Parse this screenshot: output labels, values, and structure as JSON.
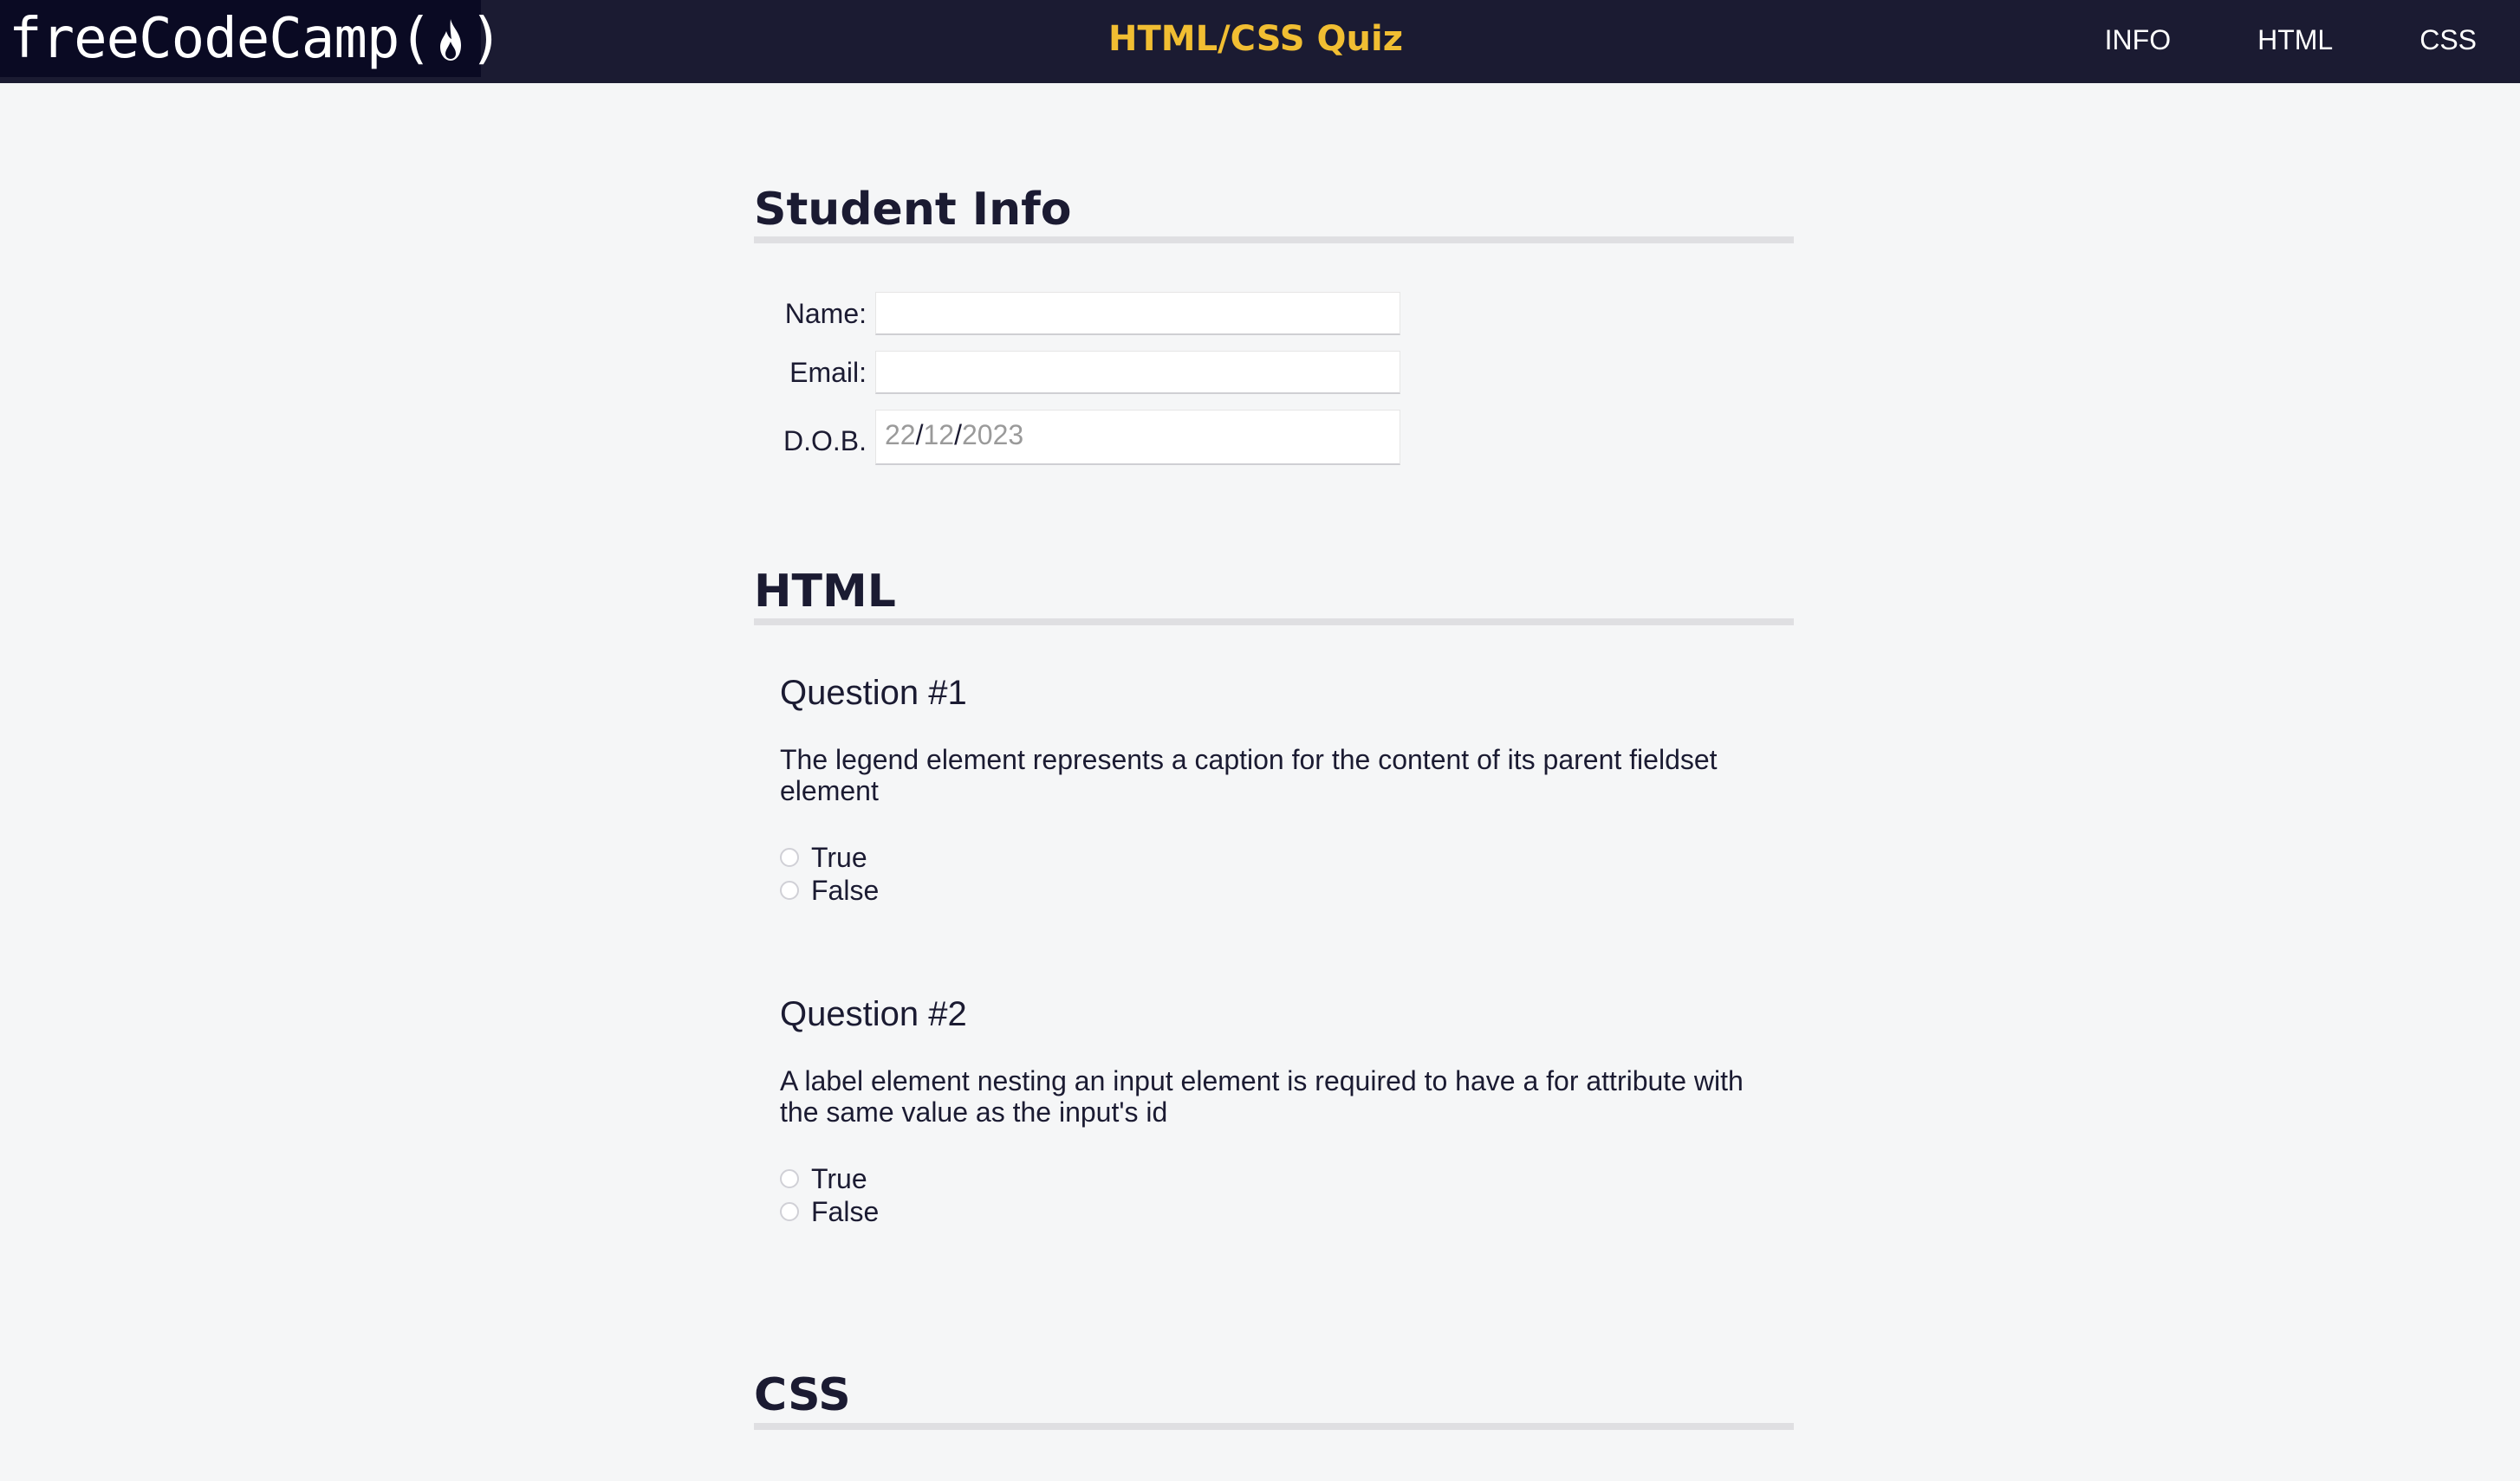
{
  "header": {
    "logo_text_left": "freeCodeCamp(",
    "logo_text_right": ")",
    "title": "HTML/CSS Quiz",
    "nav": [
      "INFO",
      "HTML",
      "CSS"
    ]
  },
  "student_info": {
    "heading": "Student Info",
    "name_label": "Name:",
    "email_label": "Email:",
    "dob_label": "D.O.B.",
    "dob_day": "22",
    "dob_month": "12",
    "dob_year": "2023",
    "dob_separator": "/"
  },
  "html_section": {
    "heading": "HTML",
    "questions": [
      {
        "title": "Question #1",
        "text": "The legend element represents a caption for the content of its parent fieldset element",
        "options": [
          "True",
          "False"
        ]
      },
      {
        "title": "Question #2",
        "text": "A label element nesting an input element is required to have a for attribute with the same value as the input's id",
        "options": [
          "True",
          "False"
        ]
      }
    ]
  },
  "css_section": {
    "heading": "CSS"
  },
  "colors": {
    "header_bg": "#1b1b32",
    "logo_bg": "#0a0a23",
    "title_accent": "#f1be32",
    "page_bg": "#f5f6f7"
  }
}
